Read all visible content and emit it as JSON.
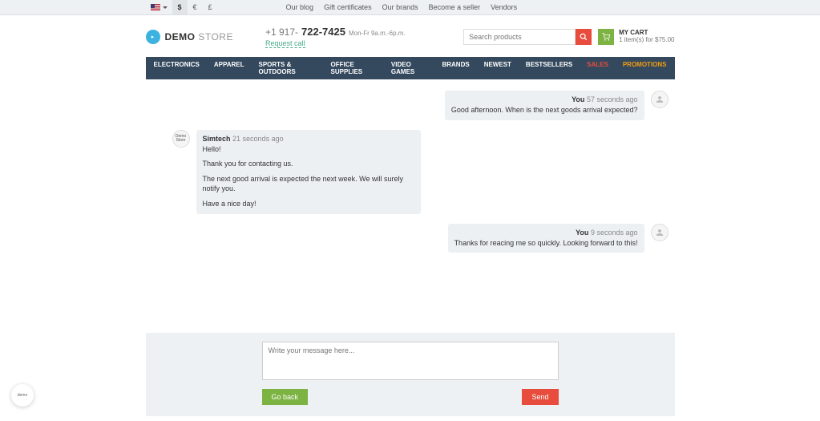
{
  "topbar": {
    "currencies": [
      "$",
      "€",
      "£"
    ],
    "links": [
      "Our blog",
      "Gift certificates",
      "Our brands",
      "Become a seller",
      "Vendors"
    ]
  },
  "header": {
    "logo_demo": "DEMO",
    "logo_store": "STORE",
    "phone_pre": "+1 917-",
    "phone_main": "722-7425",
    "phone_hours": "Mon-Fr 9a.m.-6p.m.",
    "request_call": "Request call",
    "search_placeholder": "Search products",
    "cart_label": "MY CART",
    "cart_info": "1 item(s) for $75.00"
  },
  "nav": {
    "items": [
      "ELECTRONICS",
      "APPAREL",
      "SPORTS & OUTDOORS",
      "OFFICE SUPPLIES",
      "VIDEO GAMES",
      "BRANDS",
      "NEWEST",
      "BESTSELLERS",
      "SALES",
      "PROMOTIONS"
    ]
  },
  "chat": {
    "msgs": [
      {
        "sender": "You",
        "time": "57 seconds ago",
        "body": "Good afternoon. When is the next goods arrival expected?"
      },
      {
        "sender": "Simtech",
        "time": "21 seconds ago",
        "p1": "Hello!",
        "p2": "Thank you for contacting us.",
        "p3": "The next good arrival is expected the next week. We will surely notify you.",
        "p4": "Have a nice day!"
      },
      {
        "sender": "You",
        "time": "9 seconds ago",
        "body": "Thanks for reacing me so quickly. Looking forward to this!"
      }
    ]
  },
  "compose": {
    "placeholder": "Write your message here...",
    "back": "Go back",
    "send": "Send"
  },
  "widget": {
    "label": "demo"
  }
}
